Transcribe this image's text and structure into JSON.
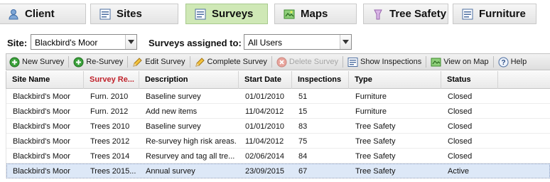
{
  "tabs": [
    {
      "label": "Client",
      "icon": "client-icon",
      "active": false
    },
    {
      "label": "Sites",
      "icon": "list-icon",
      "active": false
    },
    {
      "label": "Surveys",
      "icon": "list-icon",
      "active": true
    },
    {
      "label": "Maps",
      "icon": "map-icon",
      "active": false
    },
    {
      "label": "Tree Safety",
      "icon": "tree-icon",
      "active": false
    },
    {
      "label": "Furniture",
      "icon": "list-icon",
      "active": false
    }
  ],
  "filters": {
    "site_label": "Site:",
    "site_value": "Blackbird's Moor",
    "assigned_label": "Surveys assigned to:",
    "assigned_value": "All Users"
  },
  "toolbar": {
    "new_survey": "New Survey",
    "re_survey": "Re-Survey",
    "edit_survey": "Edit Survey",
    "complete_survey": "Complete Survey",
    "delete_survey": "Delete Survey",
    "show_inspections": "Show Inspections",
    "view_on_map": "View on Map",
    "help": "Help"
  },
  "grid": {
    "columns": [
      "Site Name",
      "Survey Re...",
      "Description",
      "Start Date",
      "Inspections",
      "Type",
      "Status"
    ],
    "sorted_column": 1,
    "rows": [
      [
        "Blackbird's Moor",
        "Furn. 2010",
        "Baseline survey",
        "01/01/2010",
        "51",
        "Furniture",
        "Closed"
      ],
      [
        "Blackbird's Moor",
        "Furn. 2012",
        "Add new items",
        "11/04/2012",
        "15",
        "Furniture",
        "Closed"
      ],
      [
        "Blackbird's Moor",
        "Trees 2010",
        "Baseline survey",
        "01/01/2010",
        "83",
        "Tree Safety",
        "Closed"
      ],
      [
        "Blackbird's Moor",
        "Trees 2012",
        "Re-survey high risk areas.",
        "11/04/2012",
        "75",
        "Tree Safety",
        "Closed"
      ],
      [
        "Blackbird's Moor",
        "Trees 2014",
        "Resurvey and tag all tre...",
        "02/06/2014",
        "84",
        "Tree Safety",
        "Closed"
      ],
      [
        "Blackbird's Moor",
        "Trees 2015...",
        "Annual survey",
        "23/09/2015",
        "67",
        "Tree Safety",
        "Active"
      ]
    ],
    "selected_row": 5
  },
  "colors": {
    "active_tab": "#cfe8b6",
    "sorted_header": "#c0222b",
    "selected_row": "#dde8f7"
  }
}
